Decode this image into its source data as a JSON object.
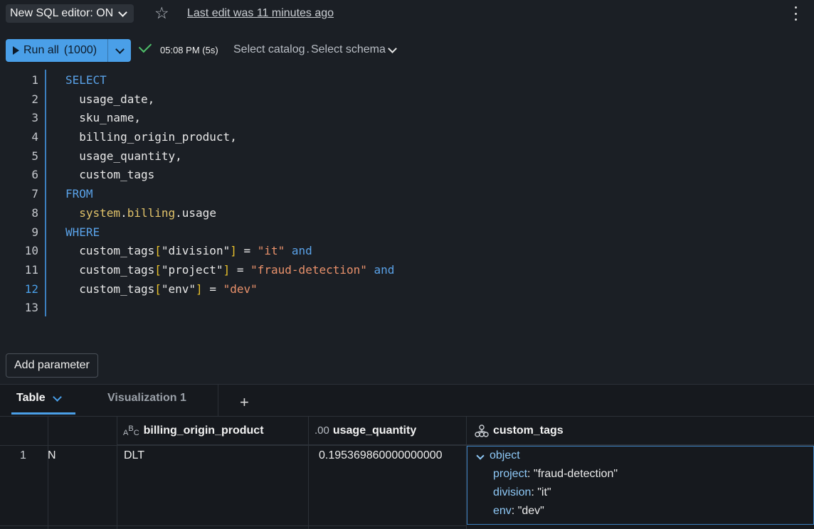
{
  "topbar": {
    "editor_toggle": "New SQL editor: ON",
    "last_edit": "Last edit was 11 minutes ago"
  },
  "runbar": {
    "run_label": "Run all",
    "run_limit": "(1000)",
    "last_run": "05:08 PM (5s)",
    "catalog": "Select catalog",
    "schema_sep": ".",
    "schema": "Select schema"
  },
  "editor": {
    "line_numbers": [
      "1",
      "2",
      "3",
      "4",
      "5",
      "6",
      "7",
      "8",
      "9",
      "10",
      "11",
      "12",
      "13"
    ],
    "active_line": "12",
    "code": {
      "l1_kw": "SELECT",
      "l2": "  usage_date,",
      "l3": "  sku_name,",
      "l4": "  billing_origin_product,",
      "l5": "  usage_quantity,",
      "l6": "  custom_tags",
      "l7_kw": "FROM",
      "l8_a": "  system",
      "l8_dot1": ".",
      "l8_b": "billing",
      "l8_dot2": ".",
      "l8_c": "usage",
      "l9_kw": "WHERE",
      "l10_a": "  custom_tags",
      "l10_key": "\"division\"",
      "l10_eq": " = ",
      "l10_val": "\"it\"",
      "l10_and": " and",
      "l11_a": "  custom_tags",
      "l11_key": "\"project\"",
      "l11_eq": " = ",
      "l11_val": "\"fraud-detection\"",
      "l11_and": " and",
      "l12_a": "  custom_tags",
      "l12_key": "\"env\"",
      "l12_eq": " = ",
      "l12_val": "\"dev\""
    }
  },
  "params": {
    "add_label": "Add parameter"
  },
  "results": {
    "tabs": [
      {
        "label": "Table"
      },
      {
        "label": "Visualization 1"
      }
    ],
    "columns": [
      {
        "type_icon": "A B C",
        "label": "billing_origin_product"
      },
      {
        "type_icon": ".00",
        "label": "usage_quantity"
      },
      {
        "type_icon": "tree-icon",
        "label": "custom_tags"
      }
    ],
    "rows": [
      {
        "index": "1",
        "partial": "N",
        "billing_origin_product": "DLT",
        "usage_quantity": "0.195369860000000000",
        "custom_tags": {
          "type": "object",
          "entries": [
            {
              "key": "project",
              "value": "\"fraud-detection\""
            },
            {
              "key": "division",
              "value": "\"it\""
            },
            {
              "key": "env",
              "value": "\"dev\""
            }
          ]
        }
      }
    ],
    "colon": ": "
  }
}
